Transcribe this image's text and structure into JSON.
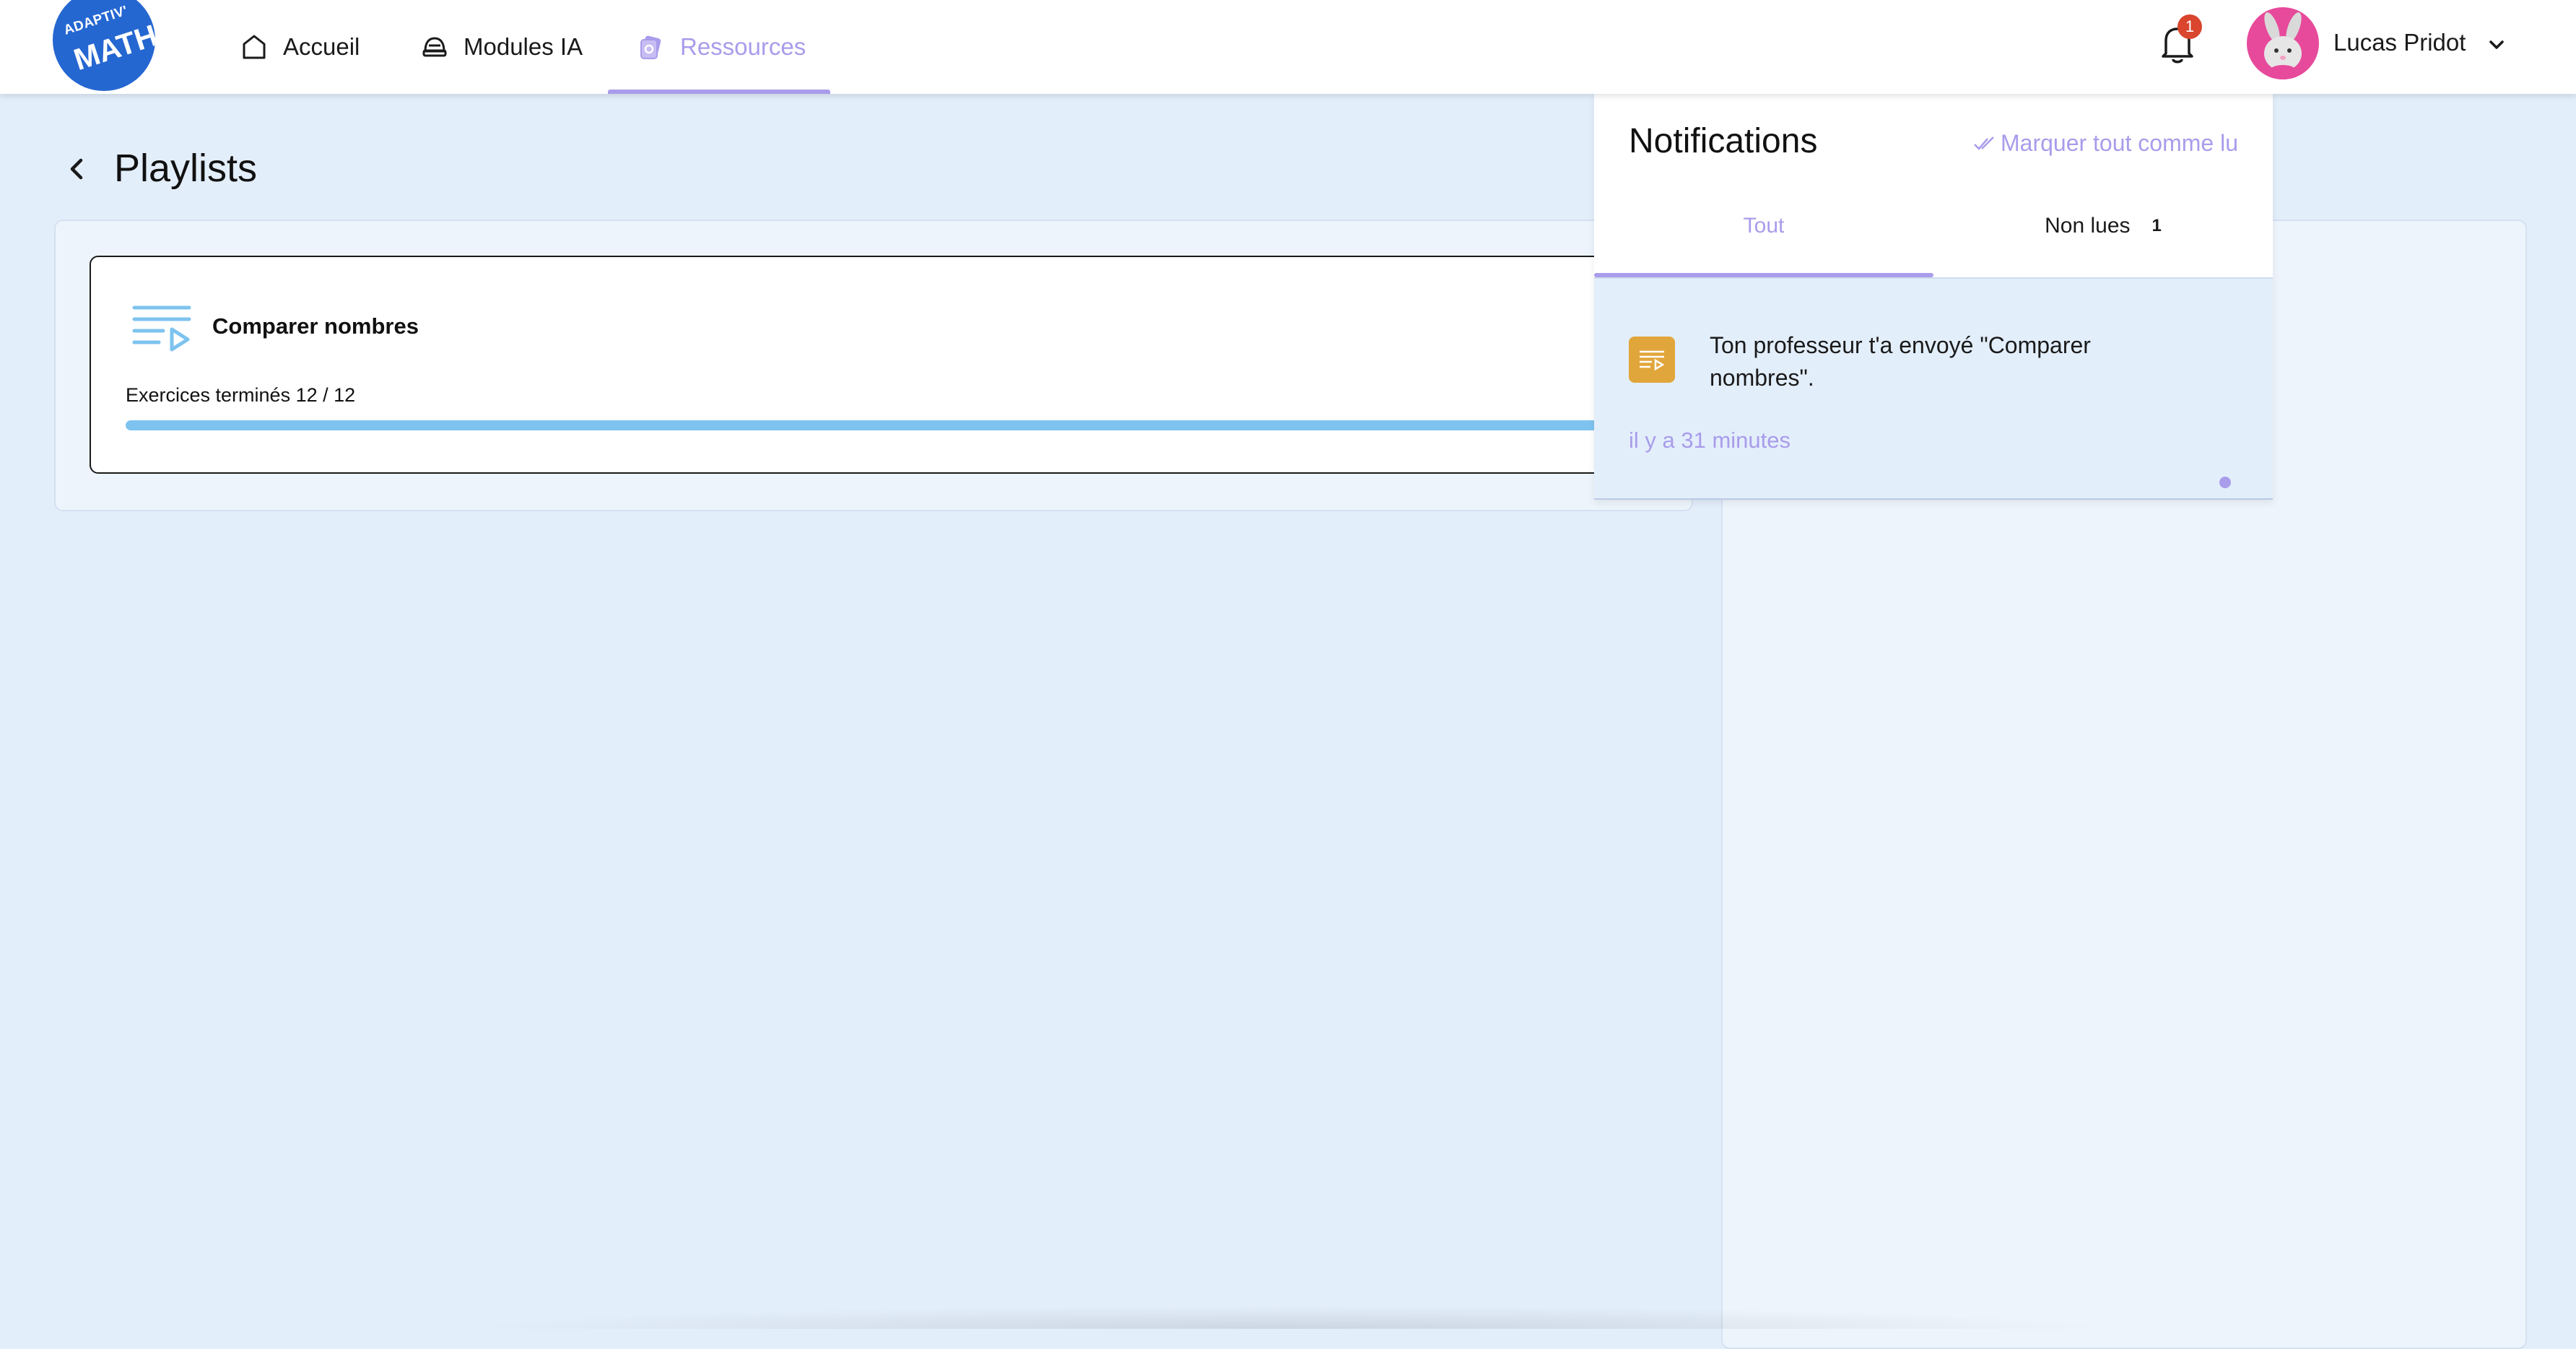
{
  "brand": {
    "logo_line1": "ADAPTIV'",
    "logo_line2": "MATH"
  },
  "nav": {
    "items": [
      {
        "label": "Accueil",
        "icon": "home-icon"
      },
      {
        "label": "Modules IA",
        "icon": "helmet-icon"
      },
      {
        "label": "Ressources",
        "icon": "resources-icon",
        "active": true
      }
    ]
  },
  "header": {
    "notifications_badge": "1",
    "user_name": "Lucas Pridot"
  },
  "page": {
    "title": "Playlists"
  },
  "playlists": [
    {
      "title": "Comparer nombres",
      "progress_label": "Exercices terminés 12 / 12",
      "completed": 12,
      "total": 12
    }
  ],
  "notifications": {
    "title": "Notifications",
    "mark_all_label": "Marquer tout comme lu",
    "tabs": [
      {
        "label": "Tout",
        "active": true
      },
      {
        "label": "Non lues",
        "count": "1"
      }
    ],
    "items": [
      {
        "text": "Ton professeur t'a envoyé \"Comparer nombres\".",
        "time": "il y a 31 minutes",
        "unread": true
      }
    ]
  },
  "colors": {
    "accent": "#a99ceb",
    "background": "#e3eefb",
    "logo": "#2567d1",
    "progress": "#7ec3ef",
    "badge": "#d9452d",
    "notification_icon": "#e1a63b"
  }
}
